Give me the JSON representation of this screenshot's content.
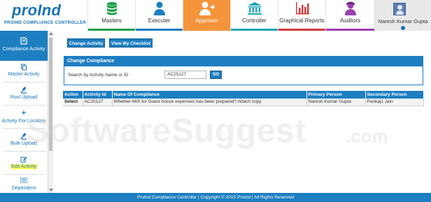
{
  "app": {
    "logo_text": "proInd",
    "logo_subtitle": "PROIND COMPLIANCE CONTROLLER"
  },
  "nav": {
    "tabs": [
      {
        "label": "Masters",
        "icon": "database-icon",
        "bar_color": "#1fa04a"
      },
      {
        "label": "Executer",
        "icon": "person-icon",
        "bar_color": "#1d7ec1"
      },
      {
        "label": "Approver",
        "icon": "user-add-icon",
        "bar_color": "#f5943b",
        "active": true
      },
      {
        "label": "Controller",
        "icon": "institution-icon",
        "bar_color": "#22a7b4"
      },
      {
        "label": "Graphical Reports",
        "icon": "bar-chart-icon",
        "bar_color": "#d23b3b"
      },
      {
        "label": "Auditors",
        "icon": "auditor-icon",
        "bar_color": "#9b3fae"
      }
    ],
    "user_name": "Naresh Kumar Gupta"
  },
  "sidebar": {
    "items": [
      {
        "label": "Compliance Activity",
        "icon": "book-icon",
        "active": true
      },
      {
        "label": "Master Activity",
        "icon": "copy-icon"
      },
      {
        "label": "Rool Upload",
        "icon": "gavel-icon"
      },
      {
        "label": "Activity For Location",
        "icon": "plus-icon"
      },
      {
        "label": "Bulk Upload",
        "icon": "gavel-icon"
      },
      {
        "label": "Edit Activity",
        "icon": "edit-icon"
      },
      {
        "label": "Dependent",
        "icon": "list-icon"
      }
    ]
  },
  "toolbar": {
    "change_activity": "Change Activity",
    "view_checklist": "View My Checklist"
  },
  "panel": {
    "title": "Change Compliance",
    "search_label": "Search by Activity Name or ID :",
    "search_value": "AC25127",
    "go_label": "GO"
  },
  "table": {
    "headers": [
      "Action",
      "Activity Id",
      "Name Of Compliance",
      "Primary Person",
      "Secondary Person"
    ],
    "rows": [
      [
        "Select",
        "AC25127",
        "Whether MIS for Guest house expenses has been prepared? Attach copy",
        "Naresh Kumar Gupta",
        "Pankaj1 Jain"
      ]
    ]
  },
  "watermark": {
    "text": "SoftwareSuggest",
    "suffix": ".com"
  },
  "footer": {
    "text": "ProInd Compliance Controller | Copyright © 2015 ProInd | All Rights Reserved"
  },
  "colors": {
    "primary": "#1d7ec1",
    "approver_tab": "#f5943b",
    "highlight": "#ffff4d"
  }
}
